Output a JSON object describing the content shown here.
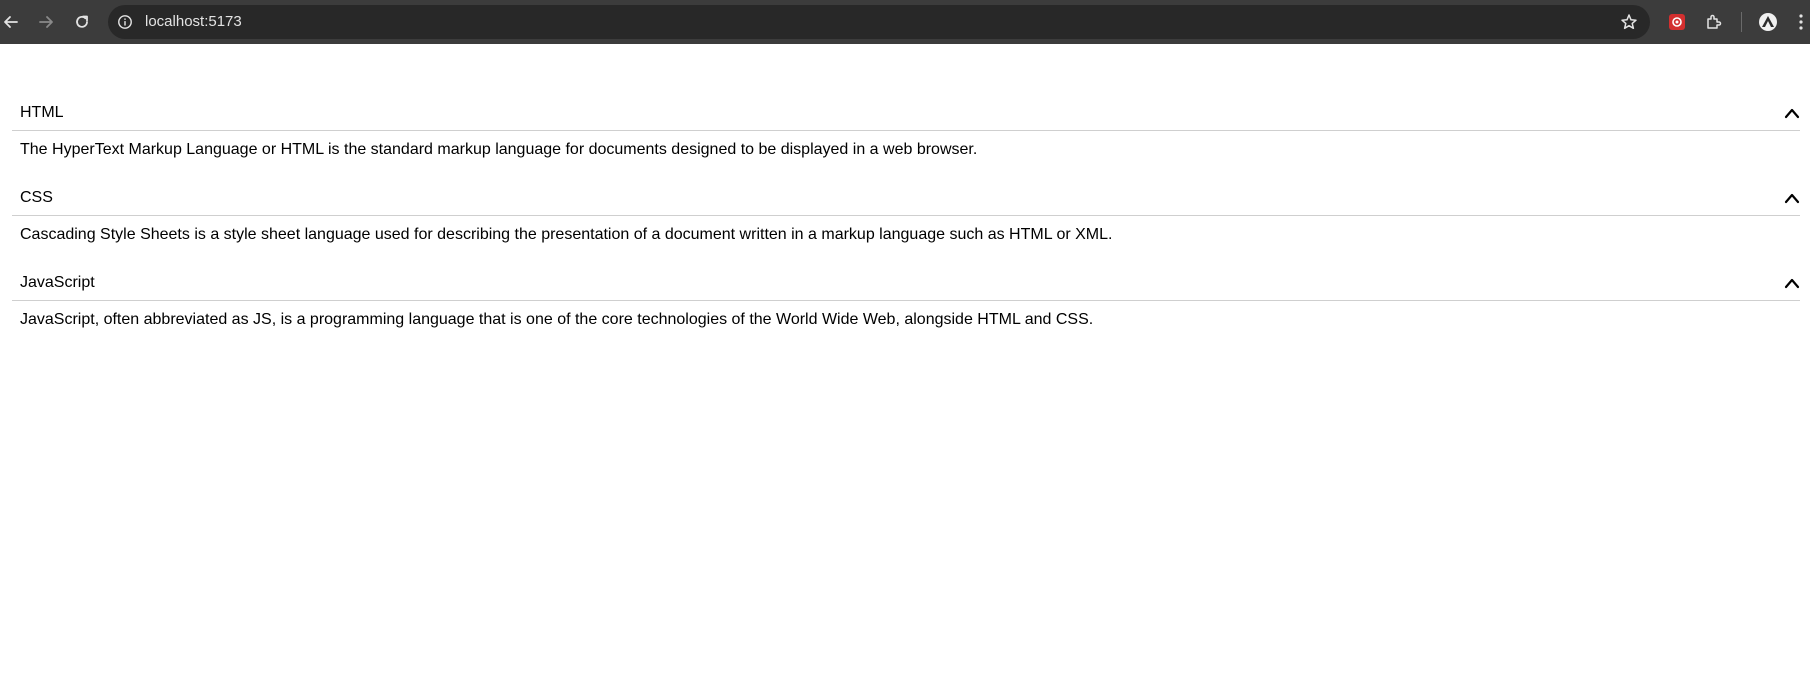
{
  "browser": {
    "url": "localhost:5173",
    "colors": {
      "toolbar": "#3c3c3c",
      "omnibox": "#282828",
      "text": "#e3e3e3"
    }
  },
  "accordion": {
    "items": [
      {
        "title": "HTML",
        "body": "The HyperText Markup Language or HTML is the standard markup language for documents designed to be displayed in a web browser.",
        "expanded": true,
        "icon": "chevron-up-icon"
      },
      {
        "title": "CSS",
        "body": "Cascading Style Sheets is a style sheet language used for describing the presentation of a document written in a markup language such as HTML or XML.",
        "expanded": true,
        "icon": "chevron-up-icon"
      },
      {
        "title": "JavaScript",
        "body": "JavaScript, often abbreviated as JS, is a programming language that is one of the core technologies of the World Wide Web, alongside HTML and CSS.",
        "expanded": true,
        "icon": "chevron-up-icon"
      }
    ]
  }
}
